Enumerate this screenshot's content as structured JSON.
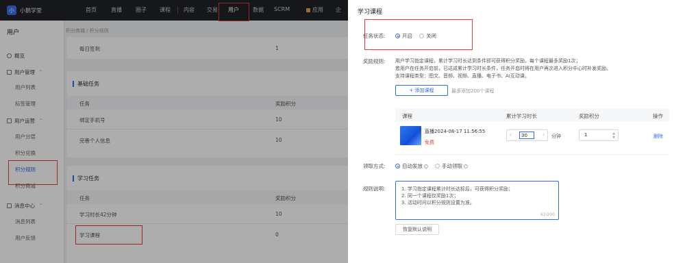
{
  "brand": {
    "logo_char": "小",
    "name": "小鹅学堂"
  },
  "nav": {
    "items": [
      "首页",
      "直播",
      "圈子",
      "课程",
      "内容",
      "交易",
      "用户",
      "数据",
      "SCRM",
      "应用",
      "企"
    ]
  },
  "sidebar": {
    "title": "用户",
    "overview": "概览",
    "groups": [
      {
        "label": "用户管理",
        "items": [
          "用户列表",
          "标签管理"
        ]
      },
      {
        "label": "用户运营",
        "items": [
          "用户分层",
          "积分兑换",
          "积分规则",
          "积分商城"
        ]
      },
      {
        "label": "消息中心",
        "items": [
          "消息列表",
          "用户反馈"
        ]
      }
    ],
    "active_item": "积分规则"
  },
  "content": {
    "breadcrumb": "积分商城 / 积分规则",
    "top_row": {
      "task": "每日签到",
      "points": "1"
    },
    "basic": {
      "title": "基础任务",
      "col_task": "任务",
      "col_points": "奖励积分",
      "rows": [
        {
          "task": "绑定手机号",
          "points": "10"
        },
        {
          "task": "完善个人信息",
          "points": "10"
        }
      ]
    },
    "learning": {
      "title": "学习任务",
      "col_task": "任务",
      "col_points": "奖励积分",
      "rows": [
        {
          "task": "学习时长42分钟",
          "points": "10"
        },
        {
          "task": "学习课程",
          "points": "0"
        }
      ]
    }
  },
  "drawer": {
    "title": "学习课程",
    "status_label": "任务状态:",
    "status_on": "开启",
    "status_off": "关闭",
    "rule_label": "奖励规则:",
    "rule_lines": [
      "用户学习指定课程，累计学习时长达到条件即可获得积分奖励，每个课程最多奖励1次；",
      "若用户在任务开启前，已达成累计学习时长条件，任务开启时将在用户再次进入积分中心时补发奖励。",
      "支持课程类型：图文、音频、视频、直播、电子书、AI互动课。"
    ],
    "add_button": "+ 添加课程",
    "add_hint": "最多添加200个课程",
    "table": {
      "col_course": "课程",
      "col_duration": "累计学习时长",
      "col_points": "奖励积分",
      "col_action": "操作",
      "row": {
        "name": "直播2024-08-17 11:56:55",
        "tag": "免费",
        "duration": "30",
        "unit": "分钟",
        "points": "1",
        "action": "删除"
      }
    },
    "claim_label": "领取方式:",
    "claim_auto": "自动发放",
    "claim_manual": "手动领取",
    "desc_label": "规则说明:",
    "desc_lines": [
      "1. 学习指定课程累计时长达标后，可获得积分奖励；",
      "2. 同一个课程仅奖励1次；",
      "3. 活动时间以积分规则设置为准。"
    ],
    "desc_count": "62/200",
    "reset_button": "恢复默认说明"
  },
  "colors": {
    "accent": "#2f6de8",
    "highlight": "#e23b3b",
    "nav_bg": "#1f2229"
  }
}
